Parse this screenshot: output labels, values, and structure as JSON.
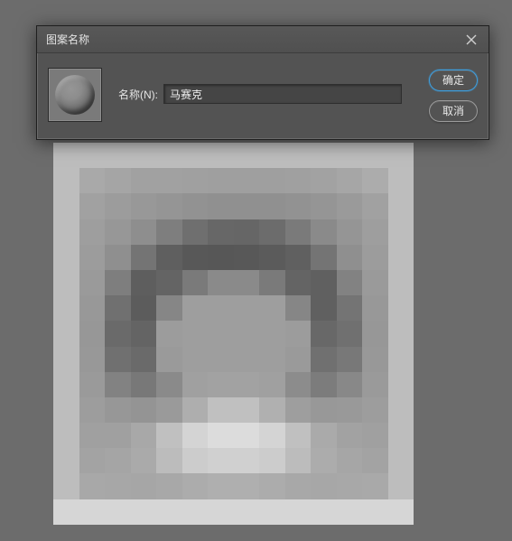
{
  "dialog": {
    "title": "图案名称",
    "name_label": "名称(N):",
    "name_value": "马赛克",
    "ok_label": "确定",
    "cancel_label": "取消"
  },
  "mosaic": {
    "cols": 14,
    "rows": 15,
    "cells": [
      [
        "#bdbdbd",
        "#bdbdbd",
        "#bdbdbd",
        "#bdbdbd",
        "#bdbdbd",
        "#bdbdbd",
        "#bdbdbd",
        "#bdbdbd",
        "#bdbdbd",
        "#bdbdbd",
        "#bdbdbd",
        "#bdbdbd",
        "#bdbdbd",
        "#bdbdbd"
      ],
      [
        "#bdbdbd",
        "#a9a9a9",
        "#a5a5a5",
        "#a1a1a1",
        "#a1a1a1",
        "#a0a0a0",
        "#9f9f9f",
        "#9f9f9f",
        "#9f9f9f",
        "#a0a0a0",
        "#a2a2a2",
        "#a6a6a6",
        "#acacac",
        "#bdbdbd"
      ],
      [
        "#bdbdbd",
        "#a1a1a1",
        "#9c9c9c",
        "#989898",
        "#959595",
        "#929292",
        "#909090",
        "#909090",
        "#909090",
        "#929292",
        "#959595",
        "#9a9a9a",
        "#a1a1a1",
        "#bdbdbd"
      ],
      [
        "#bdbdbd",
        "#9e9e9e",
        "#979797",
        "#8e8e8e",
        "#7e7e7e",
        "#6f6f6f",
        "#676767",
        "#666666",
        "#6c6c6c",
        "#7a7a7a",
        "#8a8a8a",
        "#959595",
        "#9e9e9e",
        "#bdbdbd"
      ],
      [
        "#bdbdbd",
        "#9c9c9c",
        "#8f8f8f",
        "#747474",
        "#5f5f5f",
        "#585858",
        "#575757",
        "#585858",
        "#5b5b5b",
        "#606060",
        "#747474",
        "#8f8f8f",
        "#9c9c9c",
        "#bdbdbd"
      ],
      [
        "#bdbdbd",
        "#9a9a9a",
        "#7e7e7e",
        "#5e5e5e",
        "#646464",
        "#7a7a7a",
        "#8a8a8a",
        "#8a8a8a",
        "#7a7a7a",
        "#646464",
        "#606060",
        "#828282",
        "#9a9a9a",
        "#bdbdbd"
      ],
      [
        "#bdbdbd",
        "#989898",
        "#707070",
        "#5c5c5c",
        "#868686",
        "#9e9e9e",
        "#9e9e9e",
        "#9e9e9e",
        "#9e9e9e",
        "#868686",
        "#606060",
        "#747474",
        "#989898",
        "#bdbdbd"
      ],
      [
        "#bdbdbd",
        "#979797",
        "#6a6a6a",
        "#646464",
        "#9c9c9c",
        "#9e9e9e",
        "#9e9e9e",
        "#9e9e9e",
        "#9e9e9e",
        "#9c9c9c",
        "#686868",
        "#707070",
        "#979797",
        "#bdbdbd"
      ],
      [
        "#bdbdbd",
        "#989898",
        "#707070",
        "#6a6a6a",
        "#9a9a9a",
        "#9e9e9e",
        "#9e9e9e",
        "#9e9e9e",
        "#9e9e9e",
        "#9a9a9a",
        "#707070",
        "#787878",
        "#989898",
        "#bdbdbd"
      ],
      [
        "#bdbdbd",
        "#9a9a9a",
        "#828282",
        "#787878",
        "#8a8a8a",
        "#a0a0a0",
        "#a2a2a2",
        "#a2a2a2",
        "#a0a0a0",
        "#8c8c8c",
        "#7c7c7c",
        "#888888",
        "#9a9a9a",
        "#bdbdbd"
      ],
      [
        "#bdbdbd",
        "#9d9d9d",
        "#979797",
        "#949494",
        "#9a9a9a",
        "#aeaeae",
        "#c0c0c0",
        "#c0c0c0",
        "#b0b0b0",
        "#9e9e9e",
        "#989898",
        "#999999",
        "#9d9d9d",
        "#bdbdbd"
      ],
      [
        "#bdbdbd",
        "#a0a0a0",
        "#a0a0a0",
        "#a8a8a8",
        "#c0c0c0",
        "#d4d4d4",
        "#dcdcdc",
        "#dcdcdc",
        "#d4d4d4",
        "#c0c0c0",
        "#aaaaaa",
        "#a2a2a2",
        "#a0a0a0",
        "#bdbdbd"
      ],
      [
        "#bdbdbd",
        "#a3a3a3",
        "#a5a5a5",
        "#aaaaaa",
        "#bcbcbc",
        "#cccccc",
        "#d0d0d0",
        "#d0d0d0",
        "#cccccc",
        "#bcbcbc",
        "#acacac",
        "#a6a6a6",
        "#a3a3a3",
        "#bdbdbd"
      ],
      [
        "#bdbdbd",
        "#a8a8a8",
        "#a7a7a7",
        "#a6a6a6",
        "#a8a8a8",
        "#acacac",
        "#afafaf",
        "#afafaf",
        "#acacac",
        "#a8a8a8",
        "#a7a7a7",
        "#a8a8a8",
        "#a9a9a9",
        "#bdbdbd"
      ],
      [
        "#d6d6d6",
        "#d6d6d6",
        "#d6d6d6",
        "#d6d6d6",
        "#d6d6d6",
        "#d6d6d6",
        "#d6d6d6",
        "#d6d6d6",
        "#d6d6d6",
        "#d6d6d6",
        "#d6d6d6",
        "#d6d6d6",
        "#d6d6d6",
        "#d6d6d6"
      ]
    ]
  }
}
